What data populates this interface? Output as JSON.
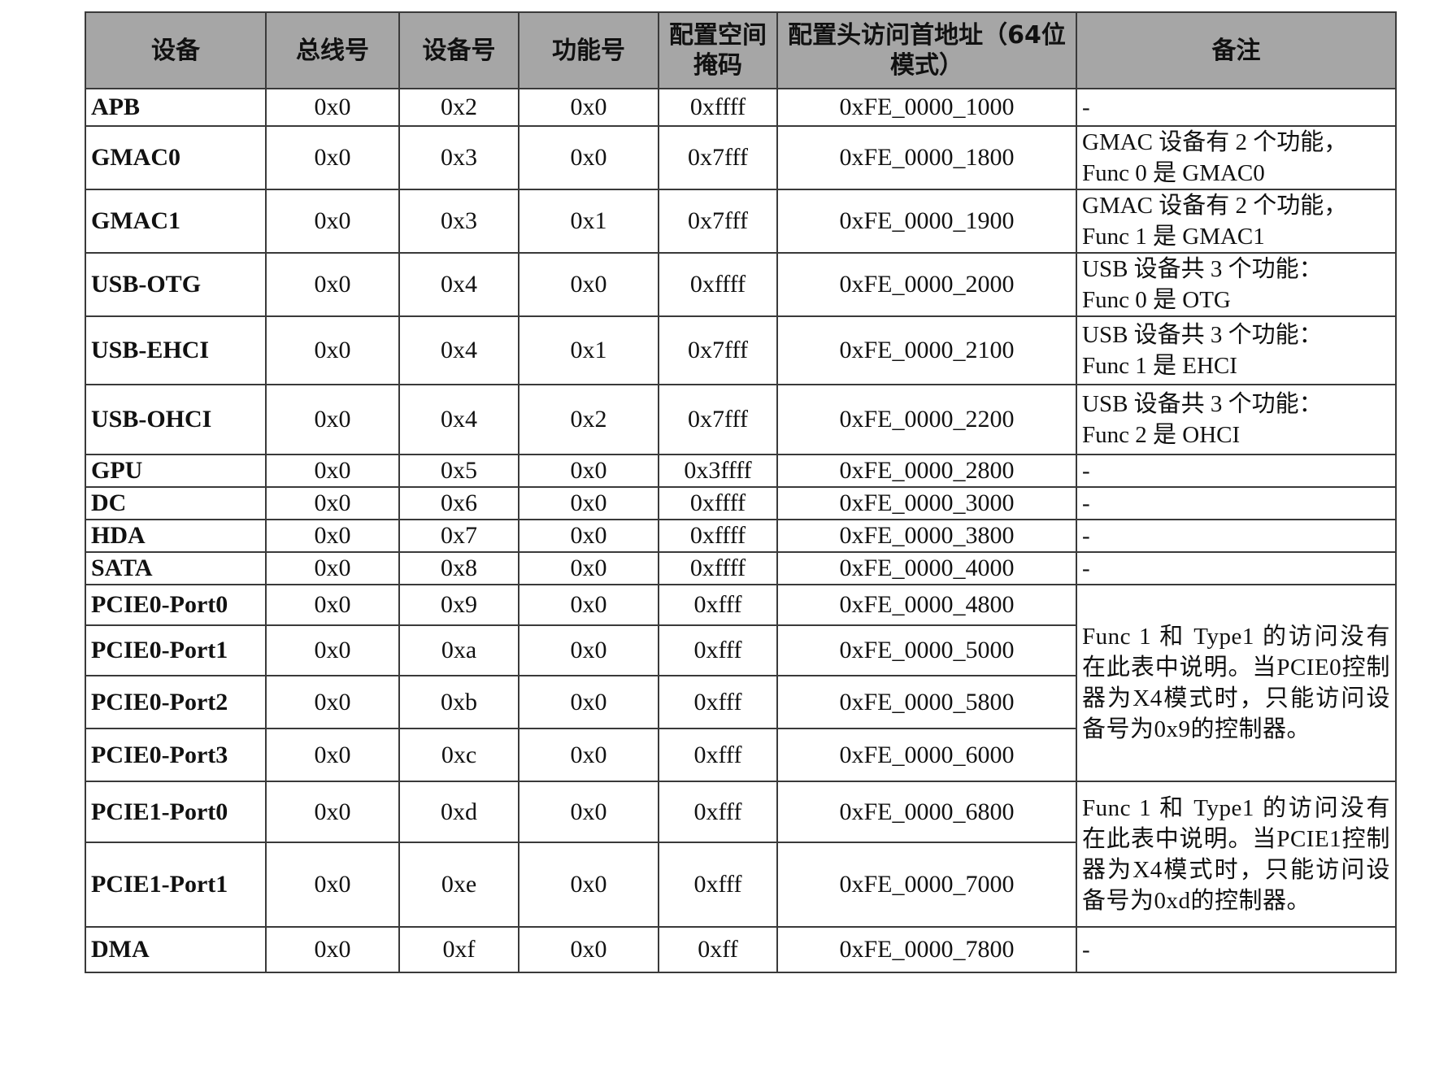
{
  "table": {
    "headers": [
      "设备",
      "总线号",
      "设备号",
      "功能号",
      "配置空间掩码",
      "配置头访问首地址（64位模式）",
      "备注"
    ],
    "rows": [
      {
        "device": "APB",
        "bus": "0x0",
        "dev": "0x2",
        "func": "0x0",
        "mask": "0xffff",
        "addr": "0xFE_0000_1000",
        "note": [
          "-"
        ]
      },
      {
        "device": "GMAC0",
        "bus": "0x0",
        "dev": "0x3",
        "func": "0x0",
        "mask": "0x7fff",
        "addr": "0xFE_0000_1800",
        "note": [
          "GMAC 设备有 2 个功能，",
          "Func 0 是 GMAC0"
        ]
      },
      {
        "device": "GMAC1",
        "bus": "0x0",
        "dev": "0x3",
        "func": "0x1",
        "mask": "0x7fff",
        "addr": "0xFE_0000_1900",
        "note": [
          "GMAC 设备有 2 个功能，",
          "Func 1 是 GMAC1"
        ]
      },
      {
        "device": "USB-OTG",
        "bus": "0x0",
        "dev": "0x4",
        "func": "0x0",
        "mask": "0xffff",
        "addr": "0xFE_0000_2000",
        "note": [
          "USB 设备共 3 个功能：",
          "Func 0 是 OTG"
        ]
      },
      {
        "device": "USB-EHCI",
        "bus": "0x0",
        "dev": "0x4",
        "func": "0x1",
        "mask": "0x7fff",
        "addr": "0xFE_0000_2100",
        "note": [
          "USB 设备共 3 个功能：",
          "Func 1 是 EHCI"
        ]
      },
      {
        "device": "USB-OHCI",
        "bus": "0x0",
        "dev": "0x4",
        "func": "0x2",
        "mask": "0x7fff",
        "addr": "0xFE_0000_2200",
        "note": [
          "USB 设备共 3 个功能：",
          "Func 2 是 OHCI"
        ]
      },
      {
        "device": "GPU",
        "bus": "0x0",
        "dev": "0x5",
        "func": "0x0",
        "mask": "0x3ffff",
        "addr": "0xFE_0000_2800",
        "note": [
          "-"
        ]
      },
      {
        "device": "DC",
        "bus": "0x0",
        "dev": "0x6",
        "func": "0x0",
        "mask": "0xffff",
        "addr": "0xFE_0000_3000",
        "note": [
          "-"
        ]
      },
      {
        "device": "HDA",
        "bus": "0x0",
        "dev": "0x7",
        "func": "0x0",
        "mask": "0xffff",
        "addr": "0xFE_0000_3800",
        "note": [
          "-"
        ]
      },
      {
        "device": "SATA",
        "bus": "0x0",
        "dev": "0x8",
        "func": "0x0",
        "mask": "0xffff",
        "addr": "0xFE_0000_4000",
        "note": [
          "-"
        ]
      },
      {
        "device": "PCIE0-Port0",
        "bus": "0x0",
        "dev": "0x9",
        "func": "0x0",
        "mask": "0xfff",
        "addr": "0xFE_0000_4800"
      },
      {
        "device": "PCIE0-Port1",
        "bus": "0x0",
        "dev": "0xa",
        "func": "0x0",
        "mask": "0xfff",
        "addr": "0xFE_0000_5000"
      },
      {
        "device": "PCIE0-Port2",
        "bus": "0x0",
        "dev": "0xb",
        "func": "0x0",
        "mask": "0xfff",
        "addr": "0xFE_0000_5800"
      },
      {
        "device": "PCIE0-Port3",
        "bus": "0x0",
        "dev": "0xc",
        "func": "0x0",
        "mask": "0xfff",
        "addr": "0xFE_0000_6000"
      },
      {
        "device": "PCIE1-Port0",
        "bus": "0x0",
        "dev": "0xd",
        "func": "0x0",
        "mask": "0xfff",
        "addr": "0xFE_0000_6800"
      },
      {
        "device": "PCIE1-Port1",
        "bus": "0x0",
        "dev": "0xe",
        "func": "0x0",
        "mask": "0xfff",
        "addr": "0xFE_0000_7000"
      },
      {
        "device": "DMA",
        "bus": "0x0",
        "dev": "0xf",
        "func": "0x0",
        "mask": "0xff",
        "addr": "0xFE_0000_7800",
        "note": [
          "-"
        ]
      }
    ],
    "merged_notes": {
      "pcie0": "Func 1 和 Type1 的访问没有在此表中说明。当PCIE0控制器为X4模式时，只能访问设备号为0x9的控制器。",
      "pcie1": "Func 1 和 Type1 的访问没有在此表中说明。当PCIE1控制器为X4模式时，只能访问设备号为0xd的控制器。"
    }
  }
}
